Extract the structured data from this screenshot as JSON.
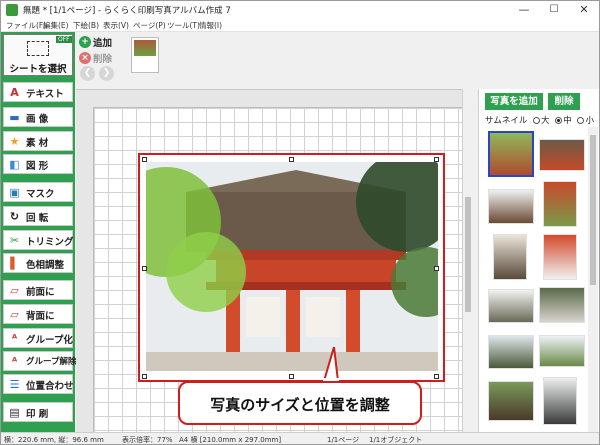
{
  "window": {
    "title": "無題 * [1/1ページ] - らくらく印刷写真アルバム作成 7",
    "min_glyph": "—",
    "max_glyph": "☐",
    "close_glyph": "✕"
  },
  "menu": [
    "ファイル(F)",
    "編集(E)",
    "下絵(B)",
    "表示(V)",
    "ページ(P)",
    "ツール(T)",
    "情報(I)"
  ],
  "left_toolbar": {
    "select_button": {
      "label": "シートを選択",
      "badge": "OFF"
    },
    "tools": [
      {
        "label": "テキスト",
        "icon": "text-icon",
        "glyph": "A",
        "color": "#d02a2a"
      },
      {
        "label": "画 像",
        "icon": "image-icon",
        "glyph": "▬",
        "color": "#2a6cc8"
      },
      {
        "label": "素 材",
        "icon": "star-icon",
        "glyph": "★",
        "color": "#f0a020"
      },
      {
        "label": "図 形",
        "icon": "shape-icon",
        "glyph": "◧",
        "color": "#3a8ad8"
      },
      {
        "label": "マスク",
        "icon": "mask-icon",
        "glyph": "▣",
        "color": "#2a7ab8"
      },
      {
        "label": "回 転",
        "icon": "rotate-icon",
        "glyph": "↻",
        "color": "#222222"
      },
      {
        "label": "トリミング",
        "icon": "scissors-icon",
        "glyph": "✂",
        "color": "#2a9a2a"
      },
      {
        "label": "色相調整",
        "icon": "color-adjust-icon",
        "glyph": "▌",
        "color": "#e05a2a"
      },
      {
        "label": "前面に",
        "icon": "bring-front-icon",
        "glyph": "▱",
        "color": "#d04040"
      },
      {
        "label": "背面に",
        "icon": "send-back-icon",
        "glyph": "▱",
        "color": "#d04040"
      },
      {
        "label": "グループ化",
        "icon": "group-icon",
        "glyph": "ᴬ",
        "color": "#d04040"
      },
      {
        "label": "グループ解除",
        "icon": "ungroup-icon",
        "glyph": "ᴬ",
        "color": "#d04040"
      },
      {
        "label": "位置合わせ",
        "icon": "align-icon",
        "glyph": "☰",
        "color": "#2a6cc8"
      },
      {
        "label": "印 刷",
        "icon": "printer-icon",
        "glyph": "▤",
        "color": "#333333"
      }
    ]
  },
  "top_toolbar": {
    "add_label": "追加",
    "delete_label": "削除",
    "prev_glyph": "❮",
    "next_glyph": "❯"
  },
  "right_panel": {
    "add_photo_label": "写真を追加",
    "delete_label": "削除",
    "thumbnail_label": "サムネイル",
    "sizes": [
      "大",
      "中",
      "小"
    ],
    "selected_size": "中"
  },
  "callout": {
    "text": "写真のサイズと位置を調整"
  },
  "status": {
    "position": "横：220.6 mm, 縦：96.6 mm",
    "zoom": "表示倍率：77%",
    "paper": "A4 横 [210.0mm x 297.0mm]",
    "page": "1/1ページ",
    "object": "1/1オブジェクト"
  }
}
